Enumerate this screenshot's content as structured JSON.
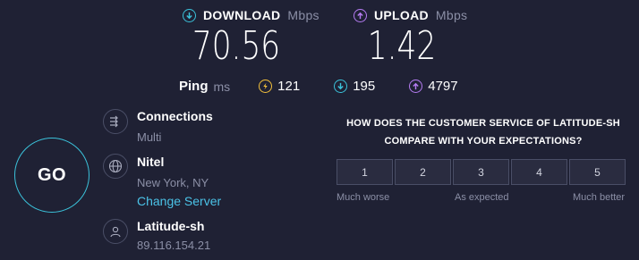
{
  "download": {
    "label": "DOWNLOAD",
    "unit": "Mbps",
    "value": "70.56",
    "color": "#3bc2da",
    "icon": "arrow-down-circle"
  },
  "upload": {
    "label": "UPLOAD",
    "unit": "Mbps",
    "value": "1.42",
    "color": "#b57cf2",
    "icon": "arrow-up-circle"
  },
  "ping": {
    "label": "Ping",
    "unit": "ms",
    "idle": {
      "value": "121",
      "color": "#f4c13b",
      "icon": "bolt-circle"
    },
    "download": {
      "value": "195",
      "color": "#3bc2da",
      "icon": "arrow-down-circle"
    },
    "upload": {
      "value": "4797",
      "color": "#b57cf2",
      "icon": "arrow-up-circle"
    }
  },
  "go_label": "GO",
  "connections": {
    "title": "Connections",
    "value": "Multi",
    "icon": "connections-icon"
  },
  "server": {
    "title": "Nitel",
    "location": "New York, NY",
    "change_label": "Change Server",
    "icon": "globe-icon"
  },
  "provider": {
    "title": "Latitude-sh",
    "ip": "89.116.154.21",
    "icon": "user-icon"
  },
  "survey": {
    "question_line1": "HOW DOES THE CUSTOMER SERVICE OF LATITUDE-SH",
    "question_line2": "COMPARE WITH YOUR EXPECTATIONS?",
    "options": [
      "1",
      "2",
      "3",
      "4",
      "5"
    ],
    "low_label": "Much worse",
    "mid_label": "As expected",
    "high_label": "Much better"
  }
}
